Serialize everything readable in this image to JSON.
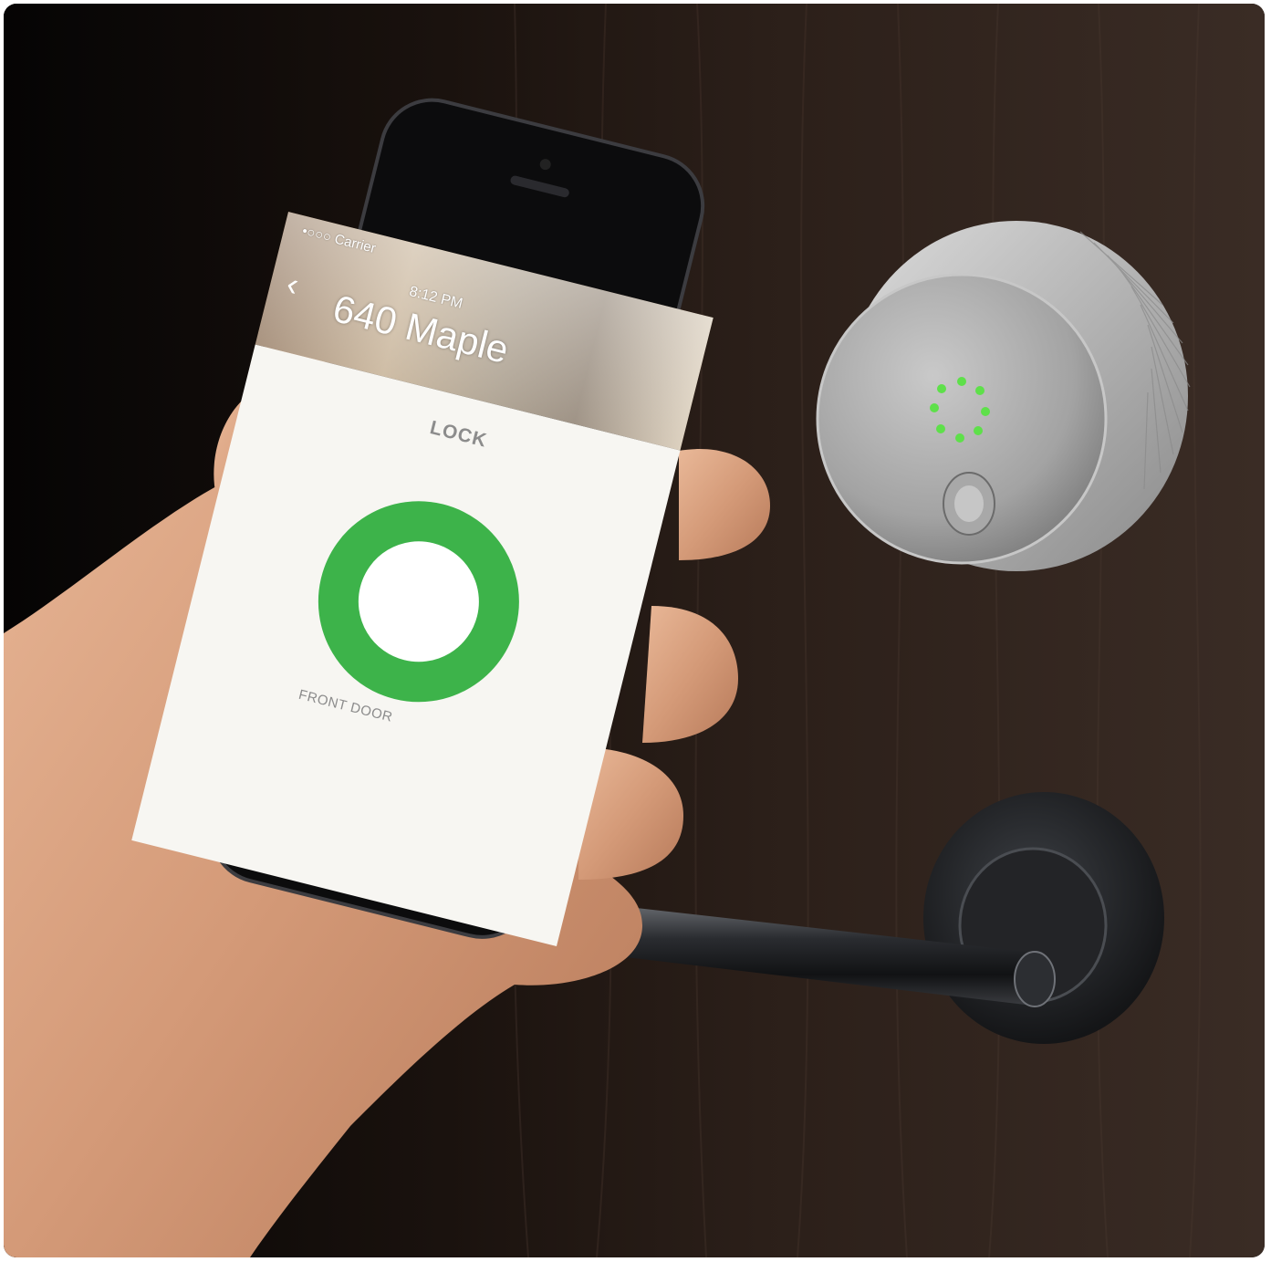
{
  "phone_app": {
    "status_carrier": "•○○○ Carrier",
    "status_time": "8:12 PM",
    "back_icon": "chevron-left-icon",
    "house_name": "640 Maple",
    "lock_label": "LOCK",
    "lock_state_color": "#3db34a",
    "door_name": "FRONT DOOR"
  },
  "smart_lock": {
    "led_color": "#5ee04a",
    "led_count": 8
  }
}
